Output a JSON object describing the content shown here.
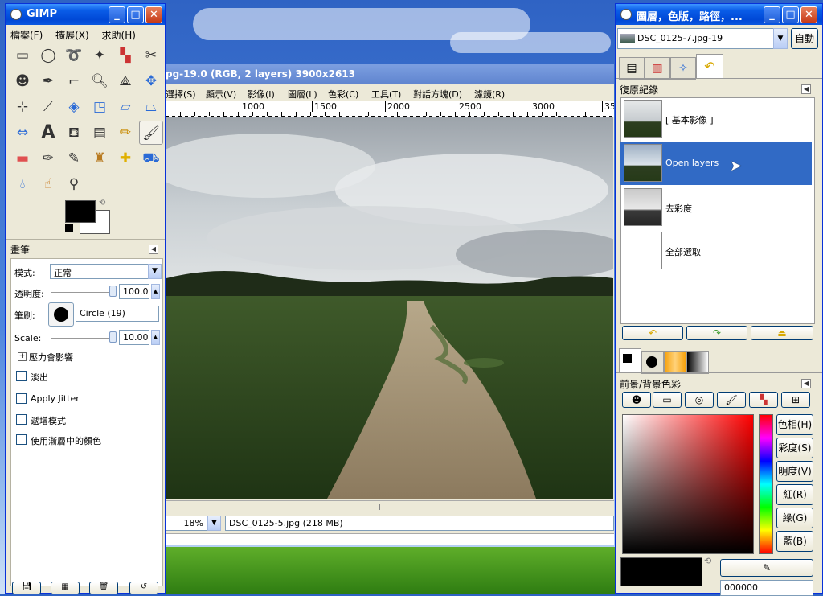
{
  "toolbox": {
    "title": "GIMP",
    "menu": [
      "檔案(F)",
      "擴展(X)",
      "求助(H)"
    ],
    "brush_panel_title": "畫筆",
    "mode_label": "模式:",
    "mode_value": "正常",
    "opacity_label": "透明度:",
    "opacity_value": "100.0",
    "opacity_level": 1.0,
    "brush_label": "筆刷:",
    "brush_value": "Circle (19)",
    "scale_label": "Scale:",
    "scale_value": "10.00",
    "scale_level": 1.0,
    "pressure_label": "壓力會影響",
    "options": [
      "淡出",
      "Apply Jitter",
      "遞增模式",
      "使用漸層中的顏色"
    ]
  },
  "image_window": {
    "title": "pg-19.0 (RGB, 2 layers) 3900x2613",
    "menu": [
      "選擇(S)",
      "顯示(V)",
      "影像(I)",
      "圖層(L)",
      "色彩(C)",
      "工具(T)",
      "對話方塊(D)",
      "濾鏡(R)"
    ],
    "ruler_ticks": [
      "1000",
      "1500",
      "2000",
      "2500",
      "3000",
      "35"
    ],
    "zoom": "18%",
    "status": "DSC_0125-5.jpg (218 MB)"
  },
  "dock": {
    "title": "圖層，色版，路徑，...",
    "image_select": "DSC_0125-7.jpg-19",
    "auto_button": "自動",
    "history_title": "復原紀錄",
    "history": [
      {
        "label": "[ 基本影像 ]",
        "selected": false
      },
      {
        "label": "Open layers",
        "selected": true
      },
      {
        "label": "去彩度",
        "selected": false
      },
      {
        "label": "全部選取",
        "selected": false
      }
    ],
    "color_title": "前景/背景色彩",
    "color_buttons": [
      "色相(H)",
      "彩度(S)",
      "明度(V)",
      "紅(R)",
      "綠(G)",
      "藍(B)"
    ],
    "hex_value": "000000"
  },
  "colors": {
    "selection": "#316ac5",
    "titlebar": "#0048d6",
    "foreground": "#000000",
    "background": "#ffffff"
  }
}
